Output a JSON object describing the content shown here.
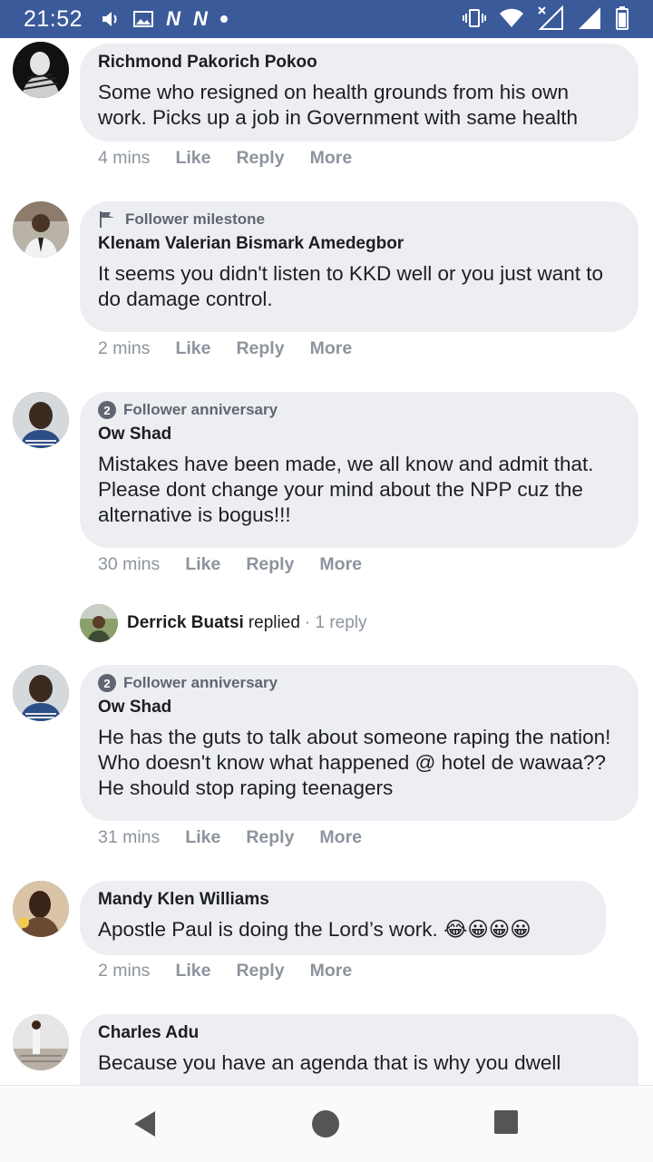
{
  "status_bar": {
    "time": "21:52",
    "left_icons": [
      "volume-icon",
      "image-icon",
      "n-icon",
      "n-icon",
      "dot-icon"
    ],
    "right_icons": [
      "vibrate-icon",
      "wifi-icon",
      "signal-x-icon",
      "signal-icon",
      "battery-icon"
    ],
    "network_glyph": "N"
  },
  "comments": [
    {
      "name": "Richmond Pakorich Pokoo",
      "text": "Some who resigned on health grounds from his own work. Picks up a job in Government with same health",
      "time": "4 mins",
      "like": "Like",
      "reply": "Reply",
      "more": "More"
    },
    {
      "badge": "Follower milestone",
      "name": "Klenam Valerian Bismark Amedegbor",
      "text": "It seems you didn't listen to KKD well or you just want to do damage control.",
      "time": "2 mins",
      "like": "Like",
      "reply": "Reply",
      "more": "More"
    },
    {
      "badge": "Follower anniversary",
      "badge_number": "2",
      "name": "Ow Shad",
      "text": "Mistakes have been made, we all know and admit that. Please dont change your mind about the NPP cuz the alternative is bogus!!!",
      "time": "30 mins",
      "like": "Like",
      "reply": "Reply",
      "more": "More",
      "reply_preview": {
        "name": "Derrick Buatsi",
        "verb": "replied",
        "count": "· 1 reply"
      }
    },
    {
      "badge": "Follower anniversary",
      "badge_number": "2",
      "name": "Ow Shad",
      "text": "He has the guts to talk about someone raping the nation! Who doesn't know what happened @ hotel de wawaa?? He should stop raping teenagers",
      "time": "31 mins",
      "like": "Like",
      "reply": "Reply",
      "more": "More"
    },
    {
      "name": "Mandy Klen Williams",
      "text": "Apostle Paul is doing the Lord’s work. 😂😀😀😀",
      "time": "2 mins",
      "like": "Like",
      "reply": "Reply",
      "more": "More"
    },
    {
      "name": "Charles Adu",
      "text": "Because you have an agenda that is why you dwell"
    }
  ],
  "colors": {
    "status_bar": "#3b5a9a",
    "bubble": "#eceef1",
    "meta_text": "#8d949e",
    "name_text": "#1c1e21"
  },
  "nav": [
    "back-icon",
    "home-icon",
    "recents-icon"
  ]
}
